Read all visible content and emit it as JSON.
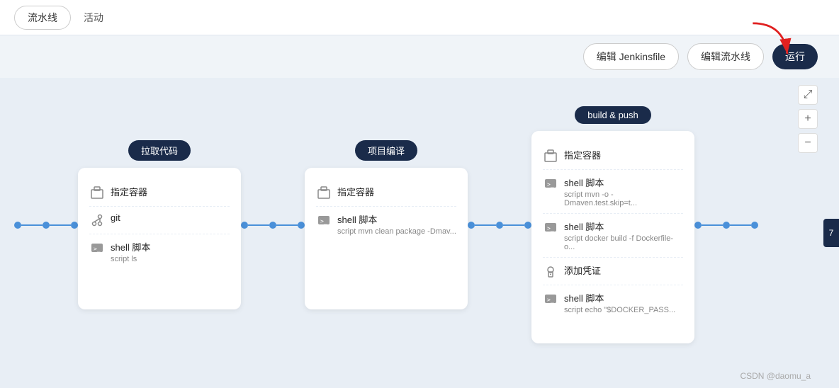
{
  "nav": {
    "tab1": "流水线",
    "tab2": "活动"
  },
  "toolbar": {
    "btn_edit_jenkinsfile": "编辑 Jenkinsfile",
    "btn_edit_pipeline": "编辑流水线",
    "btn_run": "运行"
  },
  "view_controls": {
    "expand": "⤢",
    "zoom_in": "+",
    "zoom_out": "−"
  },
  "stages": [
    {
      "id": "stage-1",
      "label": "拉取代码",
      "steps": [
        {
          "type": "container",
          "title": "指定容器",
          "sub": ""
        },
        {
          "type": "git",
          "title": "git",
          "sub": ""
        },
        {
          "type": "shell",
          "title": "shell 脚本",
          "sub": "script   ls"
        }
      ]
    },
    {
      "id": "stage-2",
      "label": "项目编译",
      "steps": [
        {
          "type": "container",
          "title": "指定容器",
          "sub": ""
        },
        {
          "type": "shell",
          "title": "shell 脚本",
          "sub": "script   mvn clean package -Dmav..."
        }
      ]
    },
    {
      "id": "stage-3",
      "label": "build & push",
      "steps": [
        {
          "type": "container",
          "title": "指定容器",
          "sub": ""
        },
        {
          "type": "shell",
          "title": "shell 脚本",
          "sub": "script   mvn -o -Dmaven.test.skip=t..."
        },
        {
          "type": "shell",
          "title": "shell 脚本",
          "sub": "script   docker build -f Dockerfile-o..."
        },
        {
          "type": "credential",
          "title": "添加凭证",
          "sub": ""
        },
        {
          "type": "shell",
          "title": "shell 脚本",
          "sub": "script   echo \"$DOCKER_PASS..."
        }
      ]
    }
  ],
  "watermark": "CSDN @daomu_a",
  "side_tab": "7"
}
